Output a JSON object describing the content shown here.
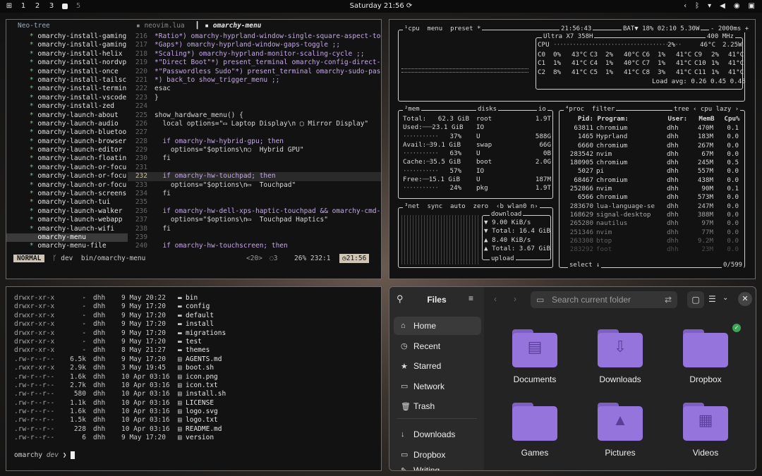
{
  "topbar": {
    "workspaces": [
      "1",
      "2",
      "3",
      "5"
    ],
    "clock": "Saturday 21:56"
  },
  "nvim": {
    "tree_header": "Neo-tree",
    "tree_items": [
      "omarchy-install-gaming",
      "omarchy-install-gaming",
      "omarchy-install-helix",
      "omarchy-install-nordvp",
      "omarchy-install-once",
      "omarchy-install-tailsc",
      "omarchy-install-termin",
      "omarchy-install-vscode",
      "omarchy-install-zed",
      "omarchy-launch-about",
      "omarchy-launch-audio",
      "omarchy-launch-bluetoo",
      "omarchy-launch-browser",
      "omarchy-launch-editor",
      "omarchy-launch-floatin",
      "omarchy-launch-or-focu",
      "omarchy-launch-or-focu",
      "omarchy-launch-or-focu",
      "omarchy-launch-screens",
      "omarchy-launch-tui",
      "omarchy-launch-walker",
      "omarchy-launch-webapp",
      "omarchy-launch-wifi",
      "omarchy-menu",
      "omarchy-menu-file"
    ],
    "tabs": [
      "neovim.lua",
      "omarchy-menu"
    ],
    "lines": [
      {
        "n": "216",
        "t": "*Ratio*) omarchy-hyprland-window-single-square-aspect-tog"
      },
      {
        "n": "217",
        "t": "*Gaps*) omarchy-hyprland-window-gaps-toggle ;;"
      },
      {
        "n": "218",
        "t": "*Scaling*) omarchy-hyprland-monitor-scaling-cycle ;;"
      },
      {
        "n": "219",
        "t": "*\"Direct Boot\"*) present_terminal omarchy-config-direct-b"
      },
      {
        "n": "220",
        "t": "*\"Passwordless Sudo\"*) present_terminal omarchy-sudo-pass"
      },
      {
        "n": "221",
        "t": "*) back_to show_trigger_menu ;;"
      },
      {
        "n": "222",
        "t": "esac"
      },
      {
        "n": "223",
        "t": "}"
      },
      {
        "n": "224",
        "t": ""
      },
      {
        "n": "225",
        "t": "show_hardware_menu() {"
      },
      {
        "n": "226",
        "t": "  local options=\"▭ Laptop Display\\n ▢ Mirror Display\""
      },
      {
        "n": "227",
        "t": ""
      },
      {
        "n": "228",
        "t": "  if omarchy-hw-hybrid-gpu; then"
      },
      {
        "n": "229",
        "t": "    options=\"$options\\n○  Hybrid GPU\""
      },
      {
        "n": "230",
        "t": "  fi"
      },
      {
        "n": "231",
        "t": ""
      },
      {
        "n": "232",
        "t": "  if omarchy-hw-touchpad; then"
      },
      {
        "n": "233",
        "t": "    options=\"$options\\n▭  Touchpad\""
      },
      {
        "n": "234",
        "t": "  fi"
      },
      {
        "n": "235",
        "t": ""
      },
      {
        "n": "236",
        "t": "  if omarchy-hw-dell-xps-haptic-touchpad && omarchy-cmd-pre"
      },
      {
        "n": "237",
        "t": "    options=\"$options\\n▭  Touchpad Haptics\""
      },
      {
        "n": "238",
        "t": "  fi"
      },
      {
        "n": "239",
        "t": ""
      },
      {
        "n": "240",
        "t": "  if omarchy-hw-touchscreen; then"
      }
    ],
    "status": {
      "mode": "NORMAL",
      "branch": "dev",
      "file": "bin/omarchy-menu",
      "lsp": "<20>",
      "diag": "3",
      "pos": "26% 232:1",
      "time": "21:56"
    }
  },
  "btop": {
    "cpu_title": "cpu",
    "menu": "menu",
    "preset": "preset *",
    "time": "21:56:43",
    "bat": "BAT▼ 18% 02:10 5.30W",
    "rate": "2000ms",
    "cpu_model": "Ultra X7 358H",
    "freq": "400 MHz",
    "cpu_total": {
      "pct": "2%",
      "temp": "46°C",
      "watt": "2.25W"
    },
    "cores": [
      [
        "C0",
        "0%",
        "43°C",
        "C3",
        "2%",
        "40°C",
        "C6",
        "1%",
        "41°C",
        "C9",
        "2%",
        "41°C"
      ],
      [
        "C1",
        "1%",
        "41°C",
        "C4",
        "1%",
        "40°C",
        "C7",
        "1%",
        "41°C",
        "C10",
        "1%",
        "41°C"
      ],
      [
        "C2",
        "8%",
        "41°C",
        "C5",
        "1%",
        "41°C",
        "C8",
        "3%",
        "41°C",
        "C11",
        "1%",
        "41°C"
      ]
    ],
    "load_avg": "Load avg: 0.26 0.45 0.48",
    "mem": {
      "total": "62.3 GiB",
      "used": "23.1 GiB",
      "used_pct": "37%",
      "avail": "39.1 GiB",
      "avail_pct": "63%",
      "cache": "35.5 GiB",
      "cache_pct": "57%",
      "free": "15.1 GiB",
      "free_pct": "24%"
    },
    "disks": [
      {
        "name": "root",
        "size": "1.9T"
      },
      {
        "name": "IO",
        "size": ""
      },
      {
        "name": "U",
        "size": "588G"
      },
      {
        "name": "swap",
        "size": "66G"
      },
      {
        "name": "U",
        "size": "0B"
      },
      {
        "name": "boot",
        "size": "2.0G"
      },
      {
        "name": "IO",
        "size": ""
      },
      {
        "name": "U",
        "size": "187M"
      },
      {
        "name": "pkg",
        "size": "1.9T"
      }
    ],
    "net": {
      "iface": "wlan0",
      "down_rate": "9.00 KiB/s",
      "down_total": "Total: 16.4 GiB",
      "up_rate": "8.40 KiB/s",
      "up_total": "Total: 3.67 GiB",
      "download_label": "download",
      "upload_label": "upload"
    },
    "proc_header": {
      "pid": "Pid:",
      "prog": "Program:",
      "user": "User:",
      "mem": "MemB",
      "cpu": "Cpu%"
    },
    "procs": [
      [
        "63811",
        "chromium",
        "dhh",
        "470M",
        "0.1"
      ],
      [
        "1465",
        "Hyprland",
        "dhh",
        "183M",
        "0.0"
      ],
      [
        "6660",
        "chromium",
        "dhh",
        "267M",
        "0.0"
      ],
      [
        "283542",
        "nvim",
        "dhh",
        "67M",
        "0.0"
      ],
      [
        "180905",
        "chromium",
        "dhh",
        "245M",
        "0.5"
      ],
      [
        "5027",
        "pi",
        "dhh",
        "557M",
        "0.0"
      ],
      [
        "68467",
        "chromium",
        "dhh",
        "438M",
        "0.0"
      ],
      [
        "252866",
        "nvim",
        "dhh",
        "90M",
        "0.1"
      ],
      [
        "6566",
        "chromium",
        "dhh",
        "573M",
        "0.0"
      ],
      [
        "283670",
        "lua-language-se",
        "dhh",
        "247M",
        "0.0"
      ],
      [
        "168629",
        "signal-desktop",
        "dhh",
        "388M",
        "0.0"
      ],
      [
        "265280",
        "nautilus",
        "dhh",
        "97M",
        "0.0"
      ],
      [
        "251346",
        "nvim",
        "dhh",
        "77M",
        "0.0"
      ],
      [
        "263308",
        "btop",
        "dhh",
        "9.2M",
        "0.0"
      ],
      [
        "283292",
        "foot",
        "dhh",
        "23M",
        "0.0"
      ]
    ],
    "proc_count": "0/599",
    "select": "select"
  },
  "terminal": {
    "rows": [
      {
        "perm": "drwxr-xr-x",
        "size": "-",
        "user": "dhh",
        "date": "9 May 20:22",
        "name": "bin",
        "icon": "folder"
      },
      {
        "perm": "drwxr-xr-x",
        "size": "-",
        "user": "dhh",
        "date": "9 May 17:20",
        "name": "config",
        "icon": "folder"
      },
      {
        "perm": "drwxr-xr-x",
        "size": "-",
        "user": "dhh",
        "date": "9 May 17:20",
        "name": "default",
        "icon": "folder"
      },
      {
        "perm": "drwxr-xr-x",
        "size": "-",
        "user": "dhh",
        "date": "9 May 17:20",
        "name": "install",
        "icon": "folder"
      },
      {
        "perm": "drwxr-xr-x",
        "size": "-",
        "user": "dhh",
        "date": "9 May 17:20",
        "name": "migrations",
        "icon": "folder"
      },
      {
        "perm": "drwxr-xr-x",
        "size": "-",
        "user": "dhh",
        "date": "9 May 17:20",
        "name": "test",
        "icon": "folder"
      },
      {
        "perm": "drwxr-xr-x",
        "size": "-",
        "user": "dhh",
        "date": "8 May 21:27",
        "name": "themes",
        "icon": "folder"
      },
      {
        "perm": ".rw-r--r--",
        "size": "6.5k",
        "user": "dhh",
        "date": "9 May 17:20",
        "name": "AGENTS.md",
        "icon": "file"
      },
      {
        "perm": ".rwxr-xr-x",
        "size": "2.9k",
        "user": "dhh",
        "date": "3 May 19:45",
        "name": "boot.sh",
        "icon": "file"
      },
      {
        "perm": ".rw-r--r--",
        "size": "1.6k",
        "user": "dhh",
        "date": "10 Apr 03:16",
        "name": "icon.png",
        "icon": "file"
      },
      {
        "perm": ".rw-r--r--",
        "size": "2.7k",
        "user": "dhh",
        "date": "10 Apr 03:16",
        "name": "icon.txt",
        "icon": "file"
      },
      {
        "perm": ".rw-r--r--",
        "size": "580",
        "user": "dhh",
        "date": "10 Apr 03:16",
        "name": "install.sh",
        "icon": "file"
      },
      {
        "perm": ".rw-r--r--",
        "size": "1.1k",
        "user": "dhh",
        "date": "10 Apr 03:16",
        "name": "LICENSE",
        "icon": "file"
      },
      {
        "perm": ".rw-r--r--",
        "size": "1.6k",
        "user": "dhh",
        "date": "10 Apr 03:16",
        "name": "logo.svg",
        "icon": "file"
      },
      {
        "perm": ".rw-r--r--",
        "size": "1.5k",
        "user": "dhh",
        "date": "10 Apr 03:16",
        "name": "logo.txt",
        "icon": "file"
      },
      {
        "perm": ".rw-r--r--",
        "size": "228",
        "user": "dhh",
        "date": "10 Apr 03:16",
        "name": "README.md",
        "icon": "file"
      },
      {
        "perm": ".rw-r--r--",
        "size": "6",
        "user": "dhh",
        "date": "9 May 17:20",
        "name": "version",
        "icon": "file"
      }
    ],
    "prompt_user": "omarchy",
    "prompt_branch": "dev",
    "prompt_arrow": "❯"
  },
  "files": {
    "title": "Files",
    "search_placeholder": "Search current folder",
    "sidebar": [
      "Home",
      "Recent",
      "Starred",
      "Network",
      "Trash",
      "Downloads",
      "Dropbox",
      "Writing"
    ],
    "folders": [
      "Documents",
      "Downloads",
      "Dropbox",
      "Games",
      "Pictures",
      "Videos"
    ],
    "accent": "#9575dc"
  }
}
